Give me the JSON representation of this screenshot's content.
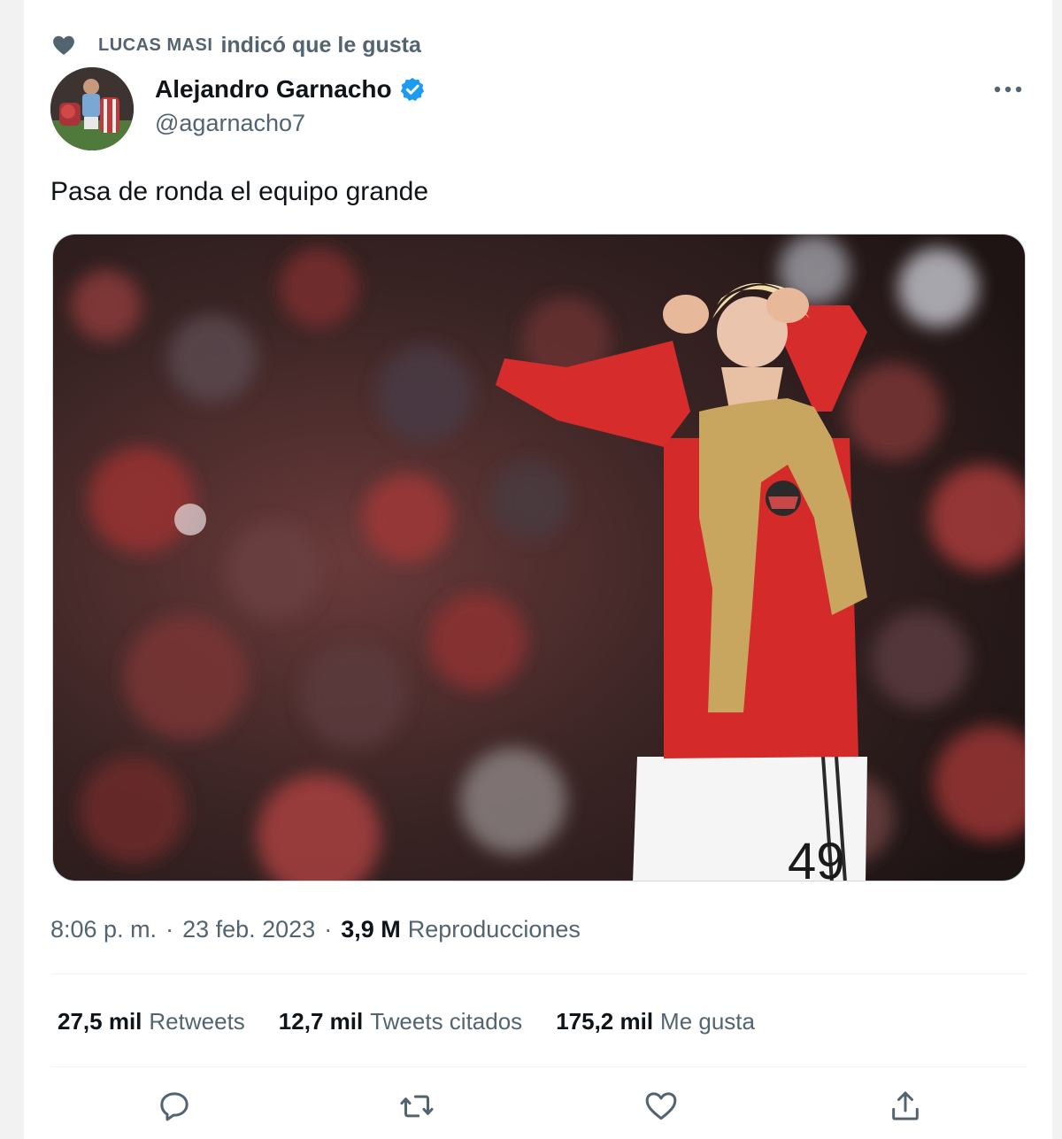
{
  "social_context": {
    "icon": "heart-icon",
    "name": "LUCAS MASI",
    "apple_glyph": "",
    "text": "indicó que le gusta"
  },
  "author": {
    "name": "Alejandro Garnacho",
    "handle": "@agarnacho7",
    "verified": true,
    "avatar": "avatar"
  },
  "tweet": {
    "text": "Pasa de ronda el equipo grande"
  },
  "meta": {
    "time": "8:06 p. m.",
    "separator": "·",
    "date": "23 feb. 2023",
    "views_count": "3,9 M",
    "views_label": "Reproducciones"
  },
  "stats": [
    {
      "num": "27,5 mil",
      "label": "Retweets"
    },
    {
      "num": "12,7 mil",
      "label": "Tweets citados"
    },
    {
      "num": "175,2 mil",
      "label": "Me gusta"
    }
  ],
  "actions": [
    "reply-icon",
    "retweet-icon",
    "like-icon",
    "share-icon"
  ],
  "colors": {
    "text_primary": "#0f1419",
    "text_secondary": "#536471",
    "verified_blue": "#1d9bf0",
    "divider": "#eff3f4"
  }
}
